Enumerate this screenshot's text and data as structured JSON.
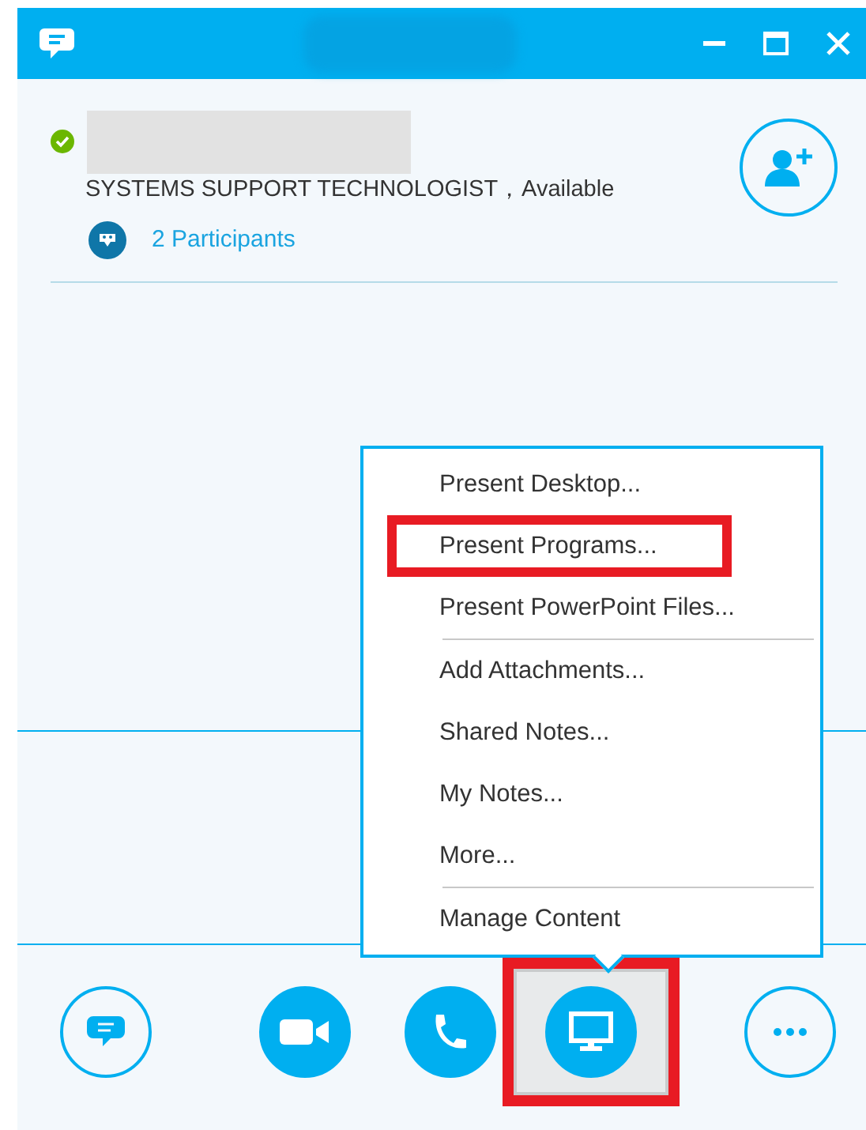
{
  "contact": {
    "available": true,
    "subtitle": "SYSTEMS SUPPORT TECHNOLOGIST，Available",
    "participants": "2 Participants"
  },
  "menu": {
    "groups": [
      [
        {
          "label": "Present Desktop...",
          "highlighted": false
        },
        {
          "label": "Present Programs...",
          "highlighted": true
        },
        {
          "label": "Present PowerPoint Files...",
          "highlighted": false
        }
      ],
      [
        {
          "label": "Add Attachments...",
          "highlighted": false
        },
        {
          "label": "Shared Notes...",
          "highlighted": false
        },
        {
          "label": "My Notes...",
          "highlighted": false
        },
        {
          "label": "More...",
          "highlighted": false
        }
      ],
      [
        {
          "label": "Manage Content",
          "highlighted": false
        }
      ]
    ]
  },
  "toolbar": [
    {
      "kind": "chat",
      "filled": false,
      "highlighted": false
    },
    {
      "kind": "video",
      "filled": true,
      "highlighted": false
    },
    {
      "kind": "call",
      "filled": true,
      "highlighted": false
    },
    {
      "kind": "present",
      "filled": true,
      "highlighted": true
    },
    {
      "kind": "more",
      "filled": false,
      "highlighted": false
    }
  ]
}
